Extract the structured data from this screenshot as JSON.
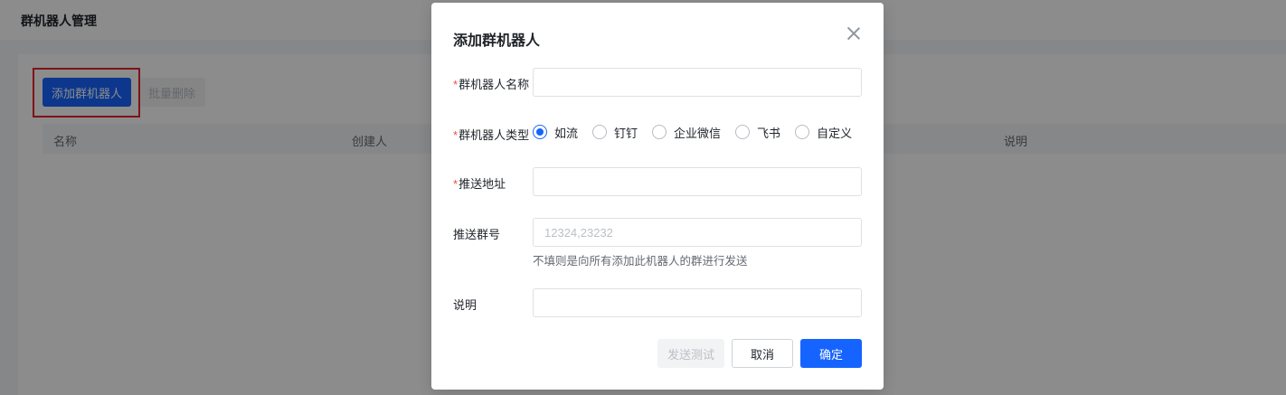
{
  "page": {
    "title": "群机器人管理",
    "add_button": "添加群机器人",
    "batch_delete_button": "批量删除",
    "table_columns": [
      "名称",
      "创建人",
      "说明"
    ]
  },
  "modal": {
    "title": "添加群机器人",
    "fields": {
      "name": {
        "label": "群机器人名称",
        "required": true,
        "value": ""
      },
      "type": {
        "label": "群机器人类型",
        "required": true,
        "options": [
          "如流",
          "钉钉",
          "企业微信",
          "飞书",
          "自定义"
        ],
        "selected": "如流"
      },
      "push_url": {
        "label": "推送地址",
        "required": true,
        "value": ""
      },
      "group_ids": {
        "label": "推送群号",
        "required": false,
        "value": "",
        "placeholder": "12324,23232",
        "help": "不填则是向所有添加此机器人的群进行发送"
      },
      "description": {
        "label": "说明",
        "required": false,
        "value": ""
      }
    },
    "buttons": {
      "test": "发送测试",
      "cancel": "取消",
      "ok": "确定"
    }
  },
  "colors": {
    "primary": "#1664ff",
    "required": "#f54a45",
    "highlight": "#e5242b"
  },
  "icons": {
    "close": "close-icon"
  }
}
